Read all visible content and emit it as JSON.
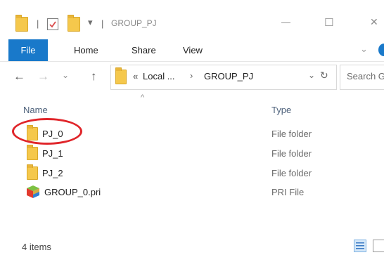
{
  "window": {
    "title": "GROUP_PJ",
    "title_sep": "|",
    "qat_dropdown_glyph": "▾",
    "minimize_glyph": "—",
    "maximize_glyph": "☐",
    "close_glyph": "✕"
  },
  "ribbon": {
    "tabs": [
      "File",
      "Home",
      "Share",
      "View"
    ],
    "collapse_glyph": "⌄"
  },
  "address": {
    "back_glyph": "←",
    "forward_glyph": "→",
    "recent_glyph": "⌄",
    "up_glyph": "↑",
    "overflow": "«",
    "crumb1": "Local ...",
    "crumb_sep": "›",
    "crumb2": "GROUP_PJ",
    "dropdown_glyph": "⌄",
    "refresh_glyph": "↻",
    "search_placeholder": "Search G"
  },
  "columns": {
    "name": "Name",
    "type": "Type",
    "sort_glyph": "^"
  },
  "files": [
    {
      "name": "PJ_0",
      "type": "File folder",
      "icon": "folder-icon",
      "highlighted": true
    },
    {
      "name": "PJ_1",
      "type": "File folder",
      "icon": "folder-icon"
    },
    {
      "name": "PJ_2",
      "type": "File folder",
      "icon": "folder-icon"
    },
    {
      "name": "GROUP_0.pri",
      "type": "PRI File",
      "icon": "pri-file-icon"
    }
  ],
  "status": {
    "item_count": "4 items"
  },
  "colors": {
    "accent": "#1979ca",
    "highlight_circle": "#e0252a",
    "folder": "#f5c84c"
  }
}
